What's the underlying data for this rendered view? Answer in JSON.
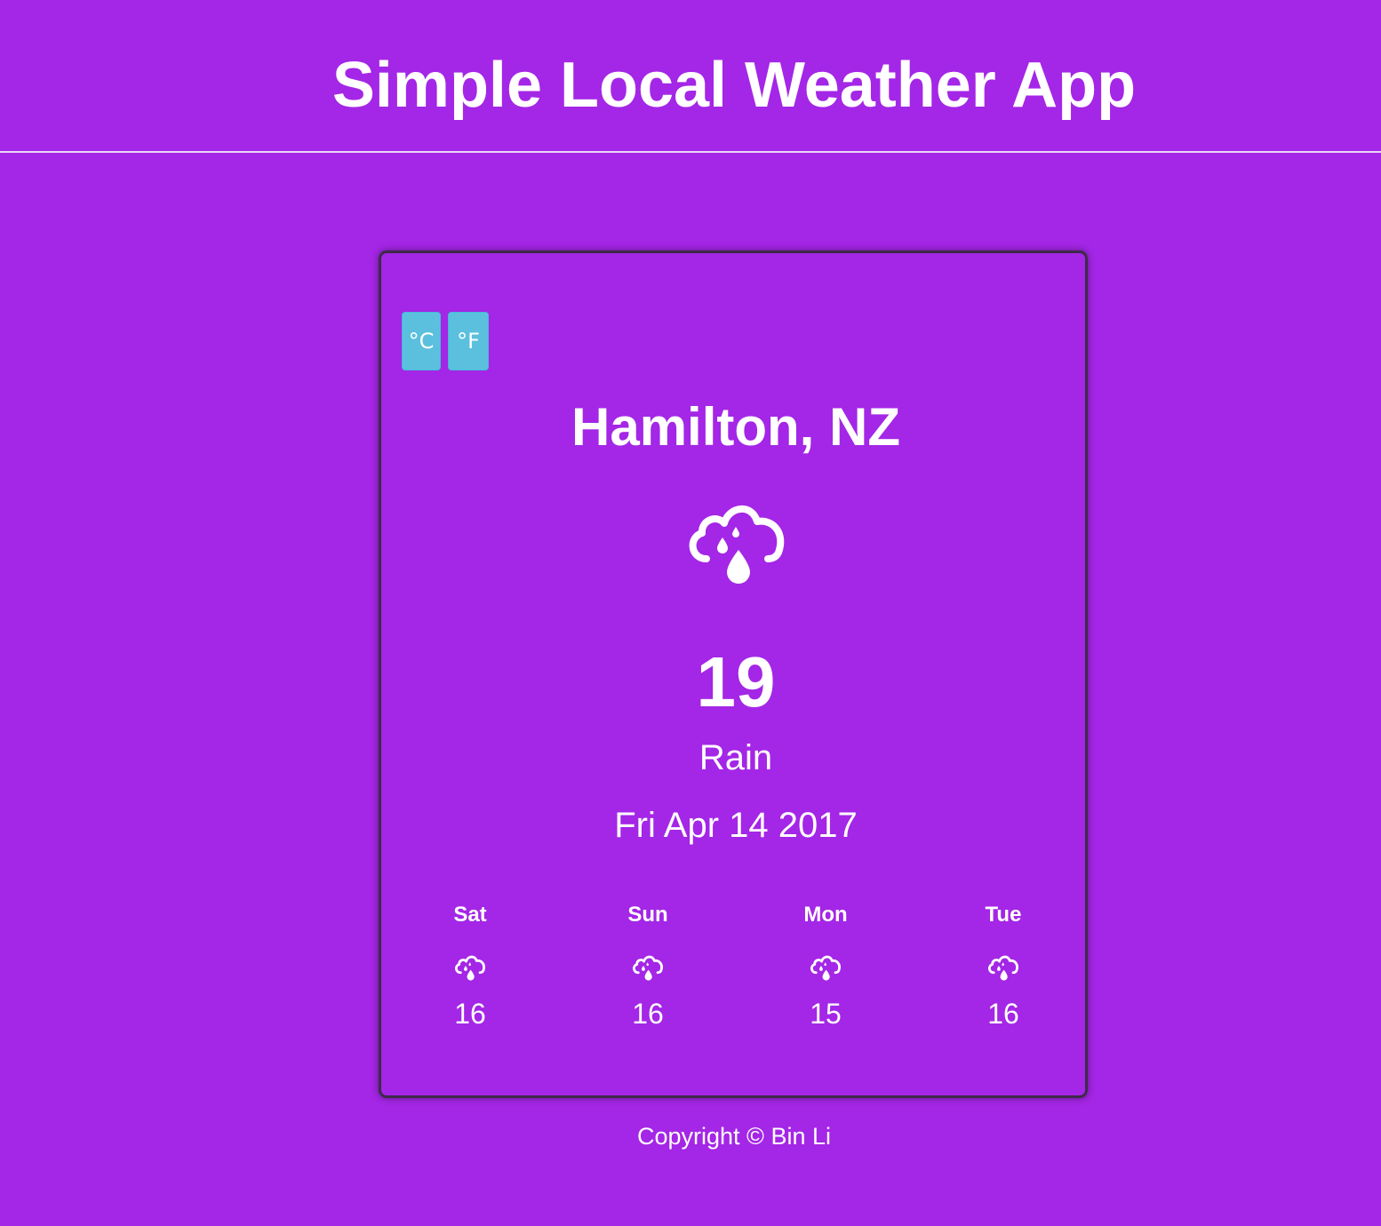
{
  "header": {
    "title": "Simple Local Weather App"
  },
  "units": {
    "celsius_label": "°C",
    "fahrenheit_label": "°F"
  },
  "current": {
    "location": "Hamilton, NZ",
    "icon": "rain-cloud-icon",
    "temperature": "19",
    "condition": "Rain",
    "date": "Fri Apr 14 2017"
  },
  "forecast": [
    {
      "day": "Sat",
      "icon": "rain-cloud-icon",
      "temp": "16"
    },
    {
      "day": "Sun",
      "icon": "rain-cloud-icon",
      "temp": "16"
    },
    {
      "day": "Mon",
      "icon": "rain-cloud-icon",
      "temp": "15"
    },
    {
      "day": "Tue",
      "icon": "rain-cloud-icon",
      "temp": "16"
    }
  ],
  "footer": {
    "text": "Copyright © Bin Li"
  },
  "colors": {
    "background": "#a426e6",
    "button": "#5bc0de",
    "text": "#ffffff"
  }
}
